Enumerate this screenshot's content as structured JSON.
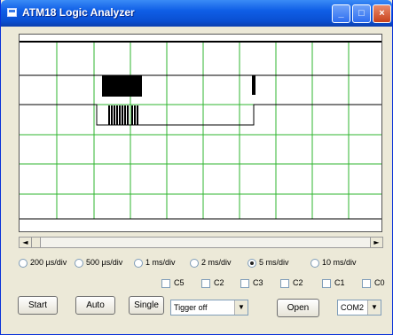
{
  "window": {
    "title": "ATM18 Logic Analyzer"
  },
  "scope": {
    "grid_color": "#2fb52f",
    "trace_color": "#000000"
  },
  "timebase": {
    "options": [
      "200 µs/div",
      "500 µs/div",
      "1 ms/div",
      "2 ms/div",
      "5 ms/div",
      "10 ms/div"
    ],
    "selected": "5 ms/div"
  },
  "channels": [
    "C5",
    "C2",
    "C3",
    "C2",
    "C1",
    "C0"
  ],
  "buttons": {
    "start": "Start",
    "auto": "Auto",
    "single": "Single",
    "open": "Open"
  },
  "trigger": {
    "value": "Tigger off"
  },
  "port": {
    "value": "COM2"
  }
}
